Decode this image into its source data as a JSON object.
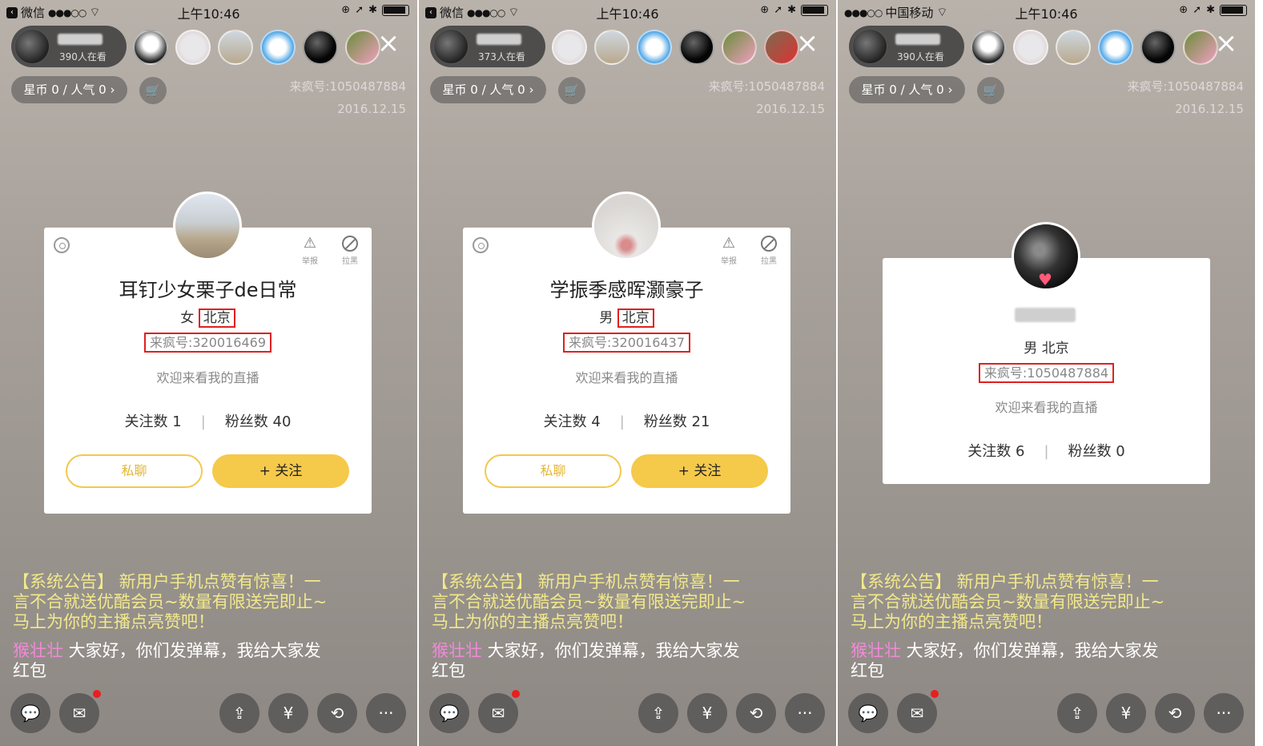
{
  "panels": [
    {
      "status": {
        "carrier": "微信",
        "signal": "●●●○○",
        "time": "上午10:46"
      },
      "host": {
        "viewers": "390人在看"
      },
      "coins": "星币 0 / 人气 0 ›",
      "room_id": "来疯号:1050487884",
      "room_date": "2016.12.15",
      "card": {
        "report_label": "举报",
        "block_label": "拉黑",
        "name": "耳钉少女栗子de日常",
        "gender": "女",
        "city": "北京",
        "id_text": "来疯号:320016469",
        "greeting": "欢迎来看我的直播",
        "following": "关注数 1",
        "fans": "粉丝数 40",
        "chat_button": "私聊",
        "follow_button": "+ 关注"
      },
      "notice": "【系统公告】 新用户手机点赞有惊喜！一言不合就送优酷会员~数量有限送完即止~马上为你的主播点亮赞吧！",
      "chat_user": "猴壮壮",
      "chat_text": " 大家好，你们发弹幕，我给大家发红包"
    },
    {
      "status": {
        "carrier": "微信",
        "signal": "●●●○○",
        "time": "上午10:46"
      },
      "host": {
        "viewers": "373人在看"
      },
      "coins": "星币 0 / 人气 0 ›",
      "room_id": "来疯号:1050487884",
      "room_date": "2016.12.15",
      "card": {
        "report_label": "举报",
        "block_label": "拉黑",
        "name": "学振季感晖灏豪子",
        "gender": "男",
        "city": "北京",
        "id_text": "来疯号:320016437",
        "greeting": "欢迎来看我的直播",
        "following": "关注数 4",
        "fans": "粉丝数 21",
        "chat_button": "私聊",
        "follow_button": "+ 关注"
      },
      "notice": "【系统公告】 新用户手机点赞有惊喜！一言不合就送优酷会员~数量有限送完即止~马上为你的主播点亮赞吧！",
      "chat_user": "猴壮壮",
      "chat_text": " 大家好，你们发弹幕，我给大家发红包"
    },
    {
      "status": {
        "carrier": "中国移动",
        "signal": "●●●○○",
        "time": "上午10:46"
      },
      "host": {
        "viewers": "390人在看"
      },
      "coins": "星币 0 / 人气 0 ›",
      "room_id": "来疯号:1050487884",
      "room_date": "2016.12.15",
      "card": {
        "gender_city": "男  北京",
        "id_text": "来疯号:1050487884",
        "greeting": "欢迎来看我的直播",
        "following": "关注数 6",
        "fans": "粉丝数 0"
      },
      "notice": "【系统公告】 新用户手机点赞有惊喜！一言不合就送优酷会员~数量有限送完即止~马上为你的主播点亮赞吧！",
      "chat_user": "猴壮壮",
      "chat_text": " 大家好，你们发弹幕，我给大家发红包"
    }
  ],
  "icons": [
    "chat-bubble-icon",
    "mail-icon",
    "share-icon",
    "gift-icon",
    "camera-flip-icon",
    "more-icon",
    "cart-icon",
    "settings-icon",
    "report-icon",
    "block-icon",
    "close-icon",
    "wifi-icon",
    "battery-icon"
  ]
}
